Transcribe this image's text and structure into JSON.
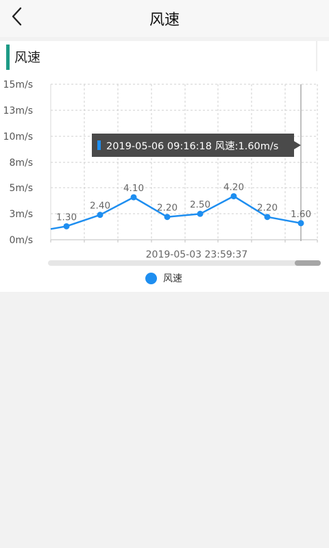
{
  "header": {
    "title": "风速"
  },
  "section": {
    "title": "风速"
  },
  "tooltip": {
    "text": "2019-05-06 09:16:18 风速:1.60m/s"
  },
  "colors": {
    "line": "#1e8ef0",
    "accent": "#1d9a86"
  },
  "chart_data": {
    "type": "line",
    "title": "",
    "y_ticks": [
      "15m/s",
      "13m/s",
      "10m/s",
      "8m/s",
      "5m/s",
      "3m/s",
      "0m/s"
    ],
    "ylim": [
      0,
      15
    ],
    "x_label_visible": "2019-05-03 23:59:37",
    "series": [
      {
        "name": "风速",
        "values": [
          1.3,
          2.4,
          4.1,
          2.2,
          2.5,
          4.2,
          2.2,
          1.6
        ]
      }
    ],
    "data_labels": [
      "1.30",
      "2.40",
      "4.10",
      "2.20",
      "2.50",
      "4.20",
      "2.20",
      "1.60"
    ],
    "grid": true,
    "legend": "bottom-center"
  }
}
